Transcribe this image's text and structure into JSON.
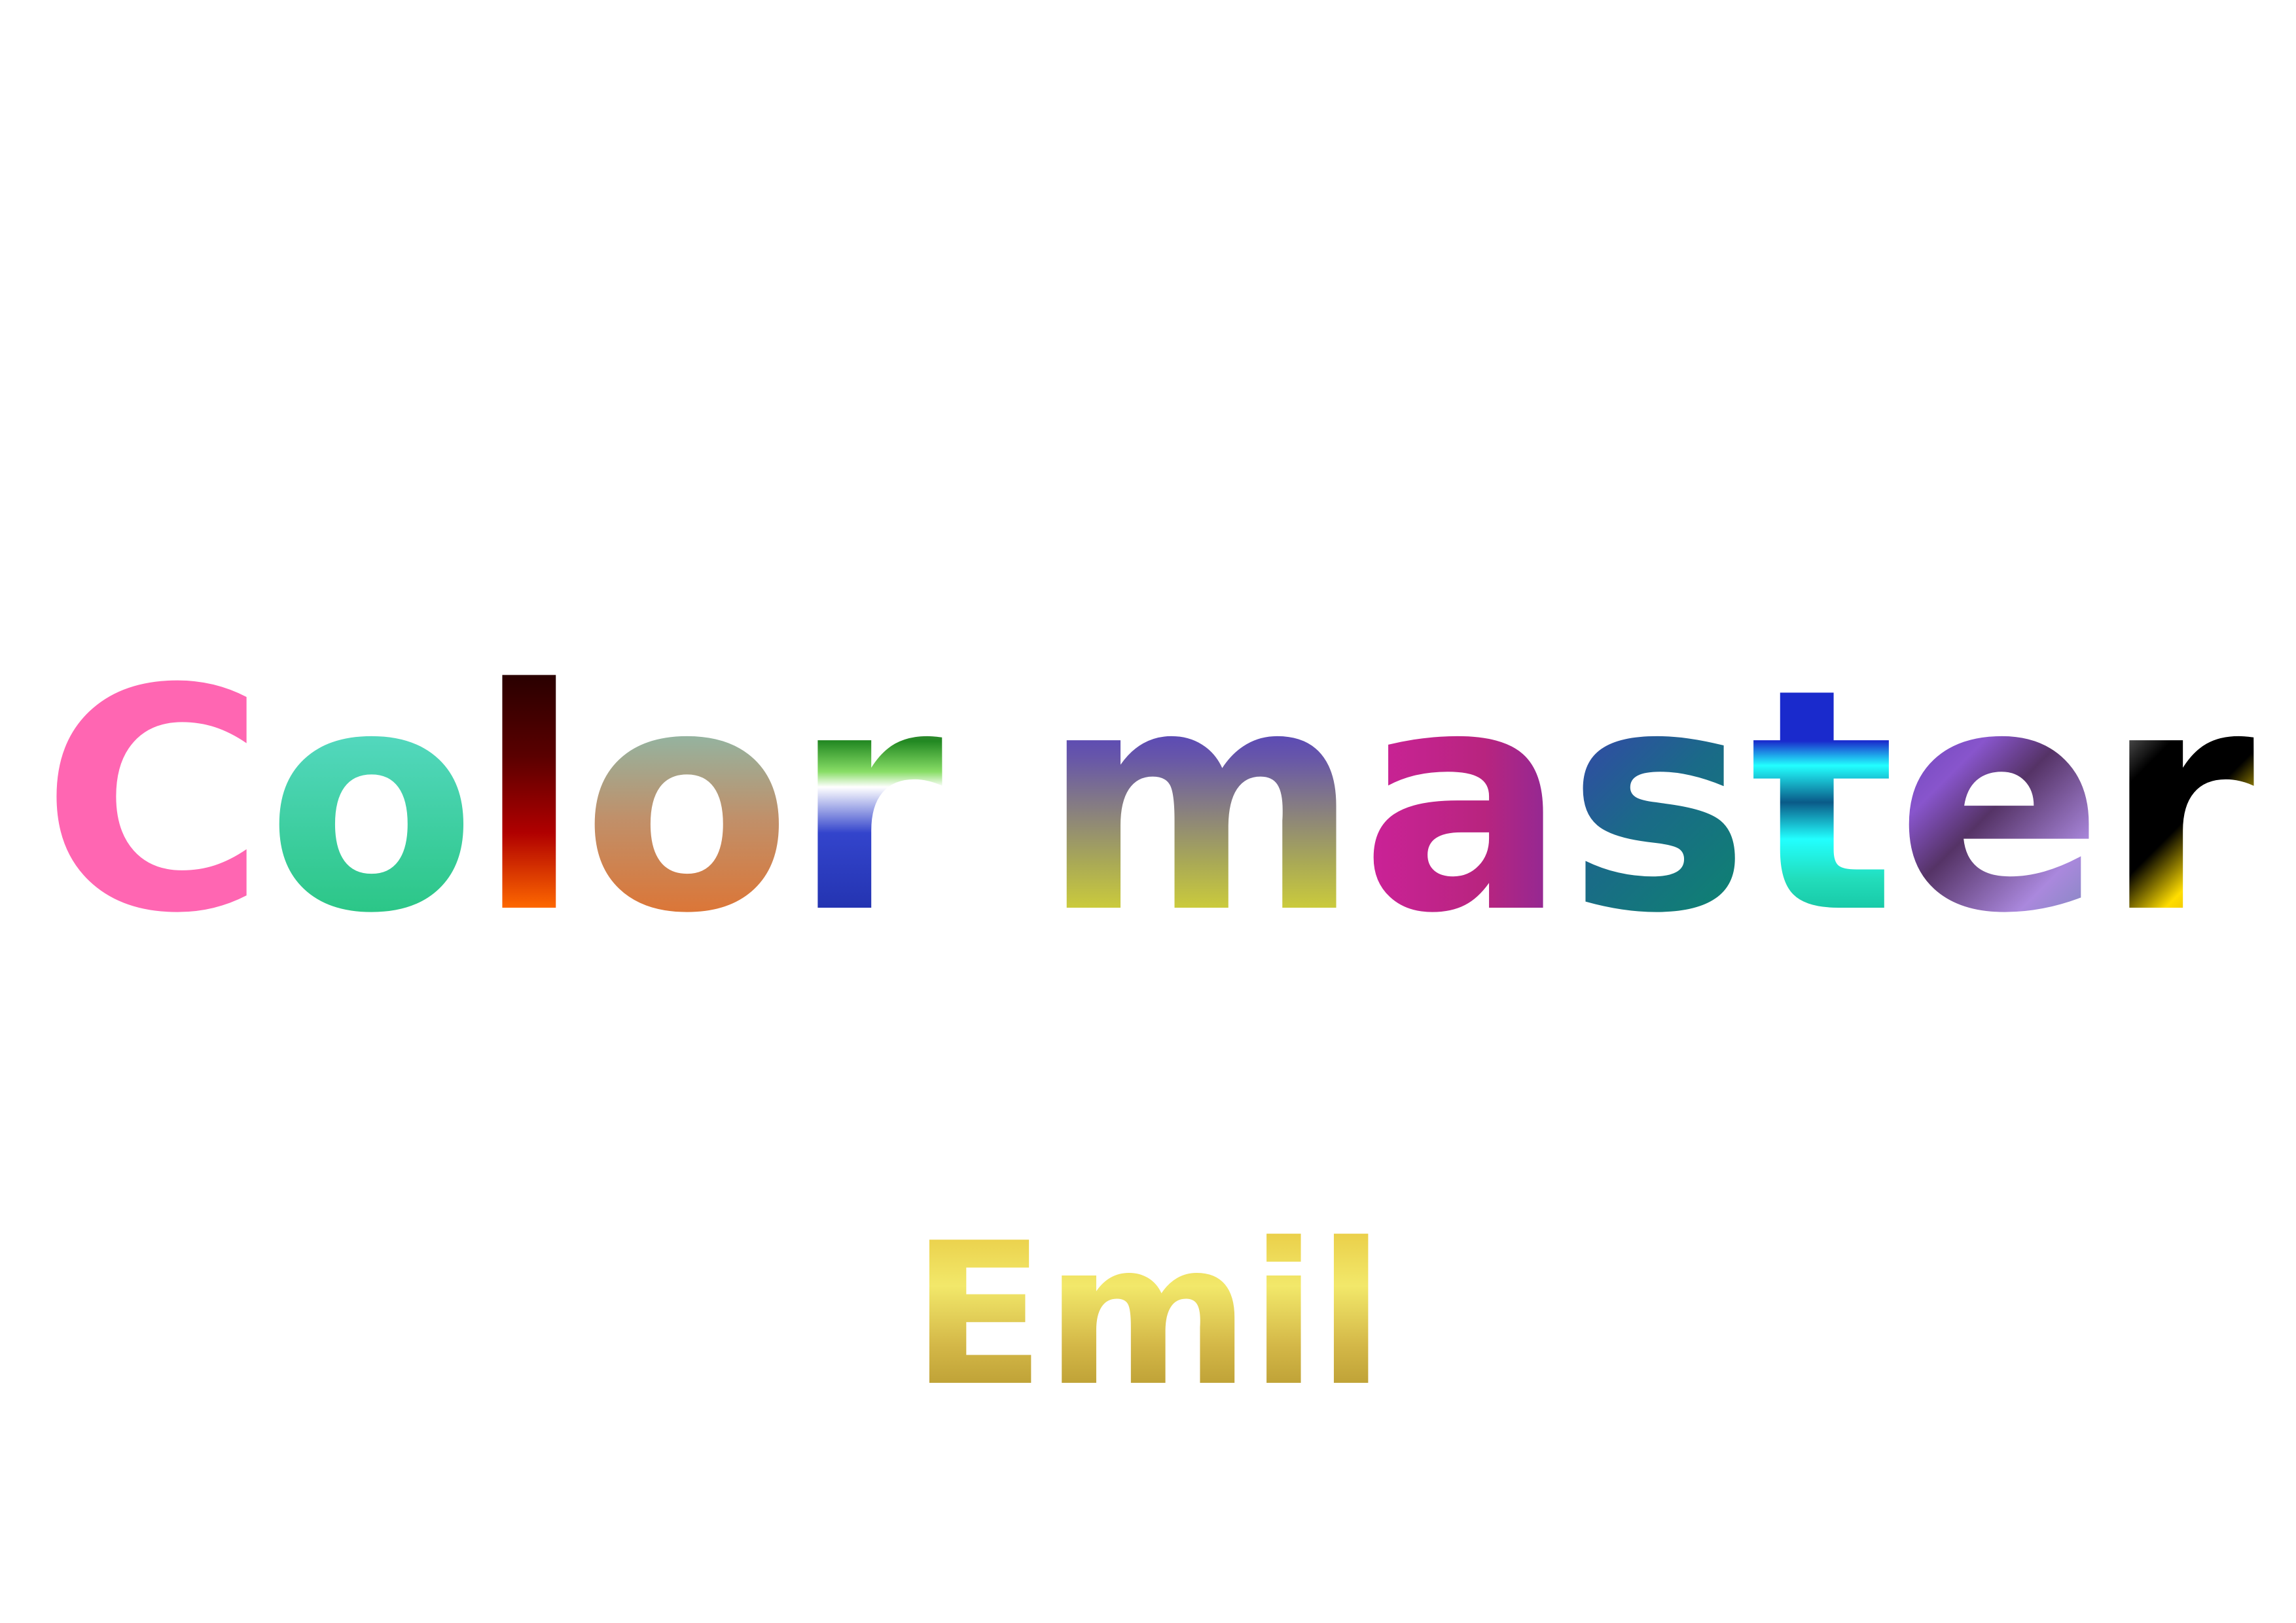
{
  "title": {
    "letters": [
      {
        "char": "C",
        "gradient": "linear-gradient(180deg, #ff66b2 0%, #ff66b2 100%)"
      },
      {
        "char": "o",
        "gradient": "linear-gradient(180deg, #66e0d8 0%, #22c27a 100%)"
      },
      {
        "char": "l",
        "gradient": "linear-gradient(180deg, #1a0000 0%, #5a0000 35%, #b00000 60%, #ff6a00 85%, #ffff00 100%)"
      },
      {
        "char": "o",
        "gradient": "linear-gradient(180deg, #66d8d8 0%, #c0906a 55%, #e86a20 100%)"
      },
      {
        "char": "r",
        "gradient": "linear-gradient(180deg, #ffffff 0%, #888888 15%, #228822 30%, #88dd66 40%, #ffffff 45%, #3344cc 60%, #1a2aa0 100%)"
      },
      {
        "char": " ",
        "gradient": ""
      },
      {
        "char": "m",
        "gradient": "linear-gradient(180deg, #3322dd 0%, #6655aa 35%, #aaaa55 70%, #eeee22 100%)"
      },
      {
        "char": "a",
        "gradient": "linear-gradient(90deg, #cc2299 0%, #b8247f 60%, #882a99 100%)"
      },
      {
        "char": "s",
        "gradient": "linear-gradient(135deg, #4433bb 0%, #1a6a88 50%, #0a8a6a 100%)"
      },
      {
        "char": "t",
        "gradient": "linear-gradient(180deg, #1a2acc 0%, #1a2acc 30%, #22ffff 38%, #0a5a88 50%, #22ffff 62%, #22ddbb 75%, #0aaa88 100%)"
      },
      {
        "char": "e",
        "gradient": "linear-gradient(135deg, #5533aa 0%, #8855cc 35%, #553366 50%, #aa88dd 75%, #6688aa 100%)"
      },
      {
        "char": "r",
        "gradient": "linear-gradient(135deg, #ffffff 0%, #000000 35%, #000000 55%, #ffdd00 70%, #aa6600 100%)"
      }
    ]
  },
  "subtitle": {
    "text": "Emil",
    "gradient": "linear-gradient(180deg, #e8c840 0%, #f2e86a 35%, #d4b848 65%, #b0922a 100%)"
  }
}
